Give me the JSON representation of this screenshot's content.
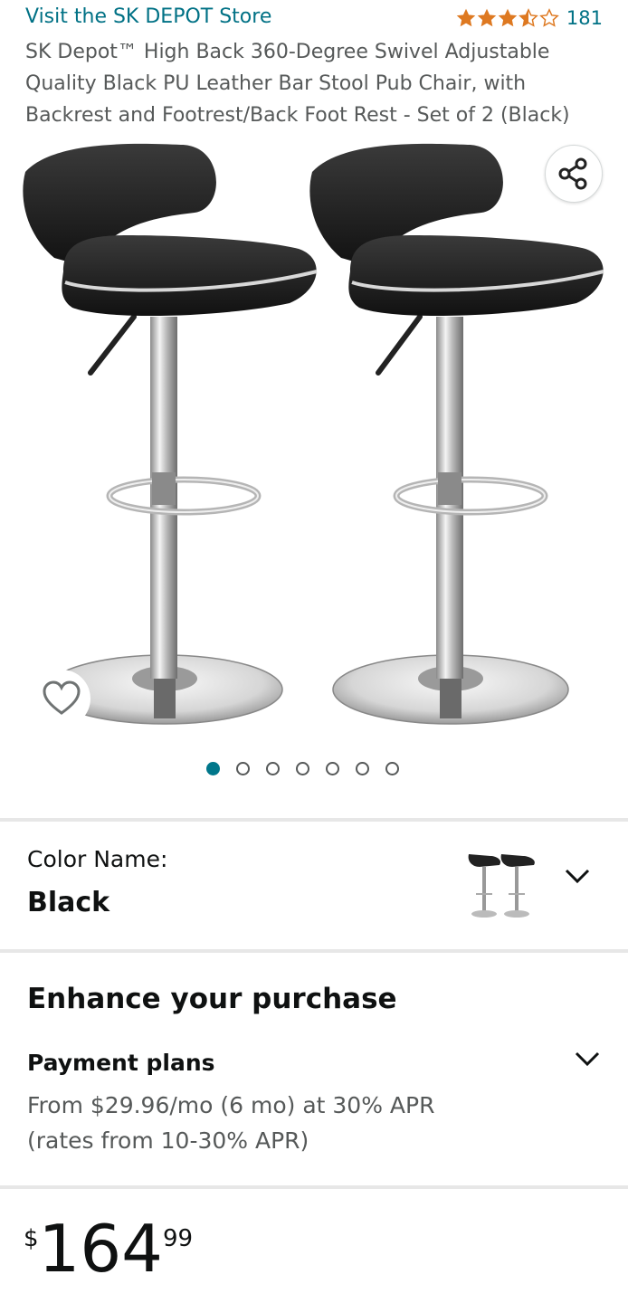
{
  "header": {
    "store_link": "Visit the SK DEPOT Store",
    "rating_stars": 3.5,
    "review_count": "181",
    "title": "SK Depot™ High Back 360-Degree Swivel Adjustable Quality Black PU Leather Bar Stool Pub Chair, with Backrest and Footrest/Back Foot Rest - Set of 2 (Black)"
  },
  "gallery": {
    "image_count": 7,
    "active_index": 0,
    "share_icon": "share-icon",
    "favorite_icon": "heart-icon"
  },
  "color": {
    "label": "Color Name:",
    "value": "Black"
  },
  "enhance": {
    "title": "Enhance your purchase",
    "payment_title": "Payment plans",
    "payment_line1": "From $29.96/mo (6 mo) at 30% APR",
    "payment_line2": "(rates from 10-30% APR)"
  },
  "price": {
    "currency": "$",
    "whole": "164",
    "fraction": "99"
  },
  "colors": {
    "link": "#007185",
    "star": "#de7921",
    "dot_active": "#00778b"
  }
}
